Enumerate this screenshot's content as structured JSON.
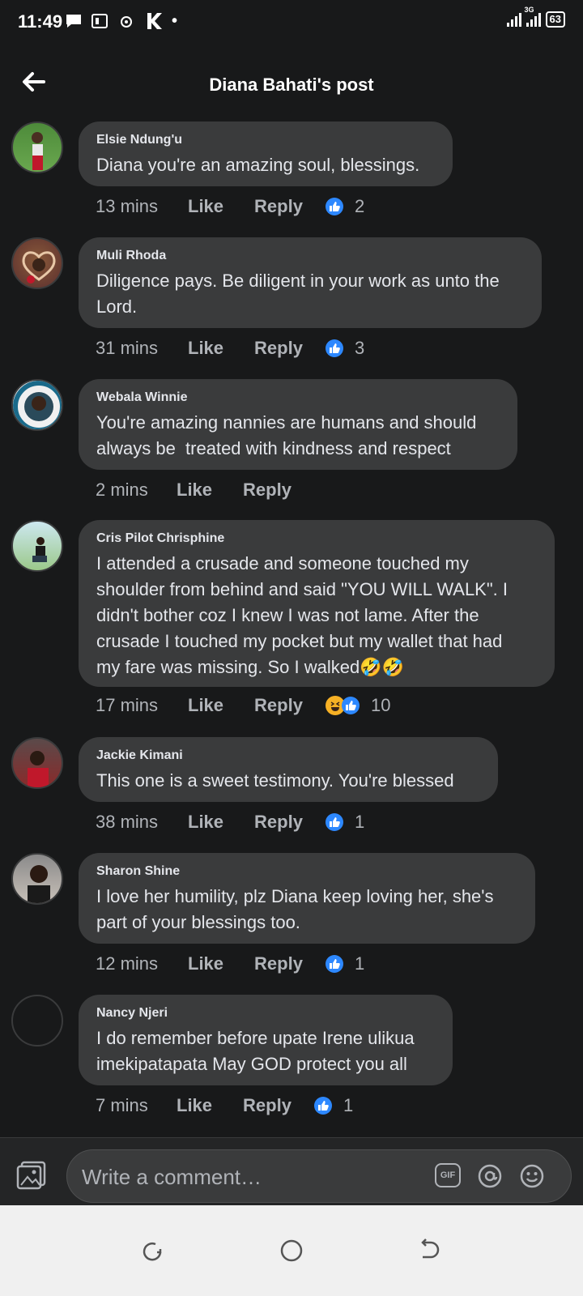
{
  "status_bar": {
    "time": "11:49",
    "icons_text": "•",
    "battery": "63",
    "network": "3G"
  },
  "header": {
    "title": "Diana  Bahati's post"
  },
  "comments": [
    {
      "name": "Elsie Ndung'u",
      "text": "Diana you're an amazing soul, blessings.",
      "time": "13 mins",
      "like": "Like",
      "reply": "Reply",
      "reactions": [
        "like"
      ],
      "count": "2"
    },
    {
      "name": "Muli Rhoda",
      "text": "Diligence pays. Be diligent in your work as unto the\nLord.",
      "time": "31 mins",
      "like": "Like",
      "reply": "Reply",
      "reactions": [
        "like"
      ],
      "count": "3"
    },
    {
      "name": "Webala Winnie",
      "text": "You're amazing nannies are humans and should\nalways be  treated with kindness and respect",
      "time": "2 mins",
      "like": "Like",
      "reply": "Reply",
      "reactions": [],
      "count": ""
    },
    {
      "name": "Cris Pilot Chrisphine",
      "text": "I attended a crusade and someone touched my\nshoulder from behind and said \"YOU WILL WALK\". I\ndidn't bother coz I knew I was not lame. After the\ncrusade I touched my pocket but my wallet that had\nmy fare was missing. So I walked🤣🤣",
      "time": "17 mins",
      "like": "Like",
      "reply": "Reply",
      "reactions": [
        "haha",
        "like"
      ],
      "count": "10"
    },
    {
      "name": "Jackie Kimani",
      "text": "This one is a sweet testimony. You're blessed",
      "time": "38 mins",
      "like": "Like",
      "reply": "Reply",
      "reactions": [
        "like"
      ],
      "count": "1"
    },
    {
      "name": "Sharon Shine",
      "text": "I love her humility, plz Diana keep loving her, she's\npart of your blessings too.",
      "time": "12 mins",
      "like": "Like",
      "reply": "Reply",
      "reactions": [
        "like"
      ],
      "count": "1"
    },
    {
      "name": "Nancy Njeri",
      "text": "I do remember before upate Irene ulikua\nimekipatapata May GOD protect you all",
      "time": "7 mins",
      "like": "Like",
      "reply": "Reply",
      "reactions": [
        "like"
      ],
      "count": "1"
    }
  ],
  "composer": {
    "placeholder": "Write a comment…",
    "gif_label": "GIF"
  },
  "colors": {
    "background": "#18191a",
    "bubble": "#3a3b3c",
    "like_blue": "#2d88ff",
    "meta_text": "#b0b3b8"
  }
}
